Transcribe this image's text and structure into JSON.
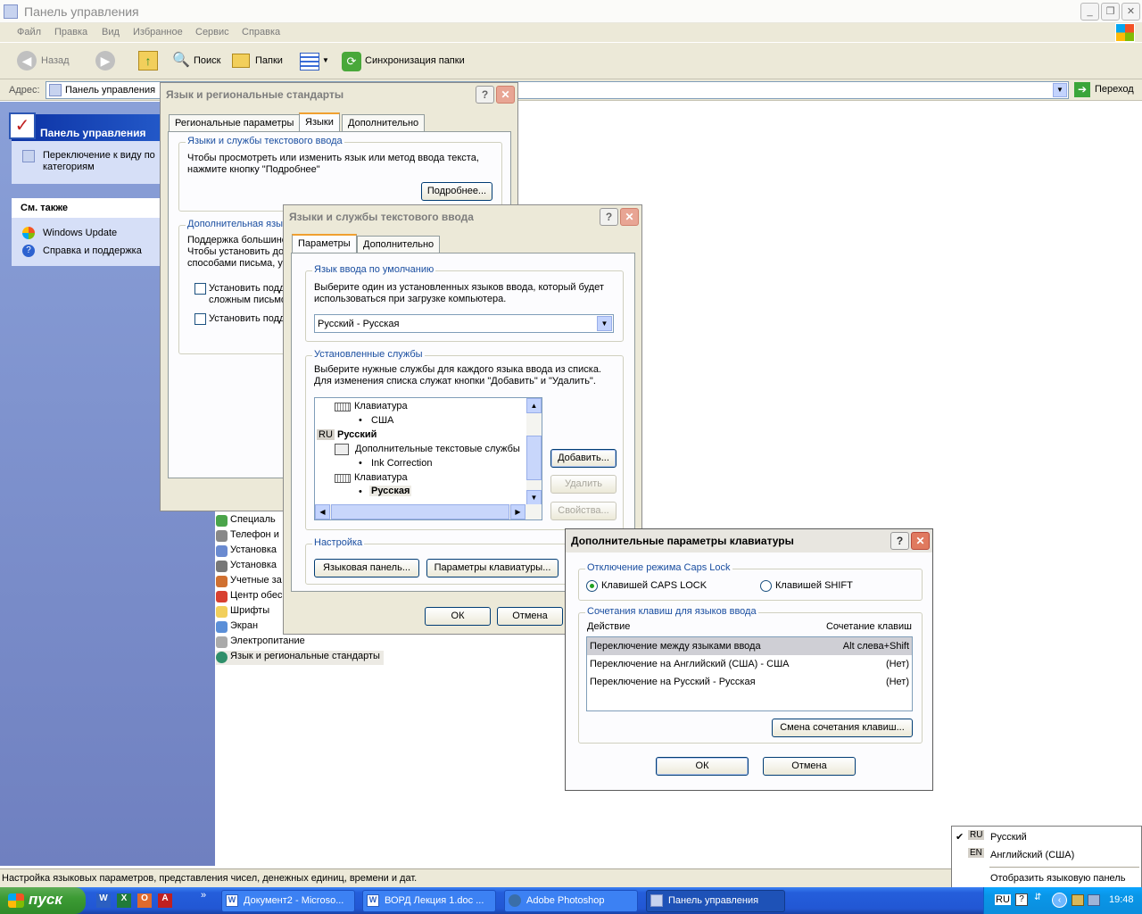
{
  "window": {
    "title": "Панель управления"
  },
  "menu": [
    "Файл",
    "Правка",
    "Вид",
    "Избранное",
    "Сервис",
    "Справка"
  ],
  "toolbar": {
    "back": "Назад",
    "search": "Поиск",
    "folders": "Папки",
    "sync": "Синхронизация папки"
  },
  "address": {
    "label": "Адрес:",
    "value": "Панель управления",
    "go": "Переход"
  },
  "left": {
    "panel_title": "Панель управления",
    "switch_view": "Переключение к виду по категориям",
    "see_also": "См. также",
    "links": [
      "Windows Update",
      "Справка и поддержка"
    ]
  },
  "items": [
    "Специаль",
    "Телефон и",
    "Установка",
    "Установка",
    "Учетные за",
    "Центр обес",
    "Шрифты",
    "Экран",
    "Электропитание",
    "Язык и региональные стандарты"
  ],
  "dlg1": {
    "title": "Язык и региональные стандарты",
    "tabs": [
      "Региональные параметры",
      "Языки",
      "Дополнительно"
    ],
    "group1": "Языки и службы текстового ввода",
    "text1": "Чтобы просмотреть или изменить язык или метод ввода текста,",
    "text1b": "нажмите кнопку \"Подробнее\"",
    "details": "Подробнее...",
    "group2": "Дополнительная язы",
    "text2a": "Поддержка большинс",
    "text2b": "Чтобы установить до",
    "text2c": "способами письма, у",
    "cb1a": "Установить подд",
    "cb1b": "сложным письмо",
    "cb2": "Установить подд"
  },
  "dlg2": {
    "title": "Языки и службы текстового ввода",
    "tabs": [
      "Параметры",
      "Дополнительно"
    ],
    "g1": "Язык ввода по умолчанию",
    "g1t1": "Выберите один из установленных языков ввода, который будет",
    "g1t2": "использоваться при загрузке компьютера.",
    "select": "Русский - Русская",
    "g2": "Установленные службы",
    "g2t1": "Выберите нужные службы для каждого языка ввода из списка.",
    "g2t2": "Для изменения списка служат кнопки \"Добавить\" и \"Удалить\".",
    "tree": {
      "kbd1": "Клавиатура",
      "usa": "США",
      "ru": "RU",
      "russian": "Русский",
      "extra": "Дополнительные текстовые службы",
      "ink": "Ink Correction",
      "kbd2": "Клавиатура",
      "russkaya": "Русская"
    },
    "add": "Добавить...",
    "remove": "Удалить",
    "props": "Свойства...",
    "g3": "Настройка",
    "langbar": "Языковая панель...",
    "kbdparams": "Параметры клавиатуры...",
    "ok": "ОК",
    "cancel": "Отмена"
  },
  "dlg3": {
    "title": "Дополнительные параметры клавиатуры",
    "g1": "Отключение режима Caps Lock",
    "r1": "Клавишей CAPS LOCK",
    "r2": "Клавишей SHIFT",
    "g2": "Сочетания клавиш для языков ввода",
    "col1": "Действие",
    "col2": "Сочетание клавиш",
    "rows": [
      {
        "a": "Переключение между языками ввода",
        "k": "Alt слева+Shift"
      },
      {
        "a": "Переключение на Английский (США) - США",
        "k": "(Нет)"
      },
      {
        "a": "Переключение на Русский - Русская",
        "k": "(Нет)"
      }
    ],
    "change": "Смена сочетания клавиш...",
    "ok": "ОК",
    "cancel": "Отмена"
  },
  "status": "Настройка языковых параметров, представления чисел, денежных единиц, времени и дат.",
  "langmenu": {
    "ru": "RU",
    "ru_label": "Русский",
    "en": "EN",
    "en_label": "Английский (США)",
    "show": "Отобразить языковую панель"
  },
  "taskbar": {
    "start": "пуск",
    "tasks": [
      "Документ2 - Microso...",
      "ВОРД Лекция 1.doc ...",
      "Adobe Photoshop",
      "Панель управления"
    ],
    "lang": "RU",
    "time": "19:48"
  }
}
